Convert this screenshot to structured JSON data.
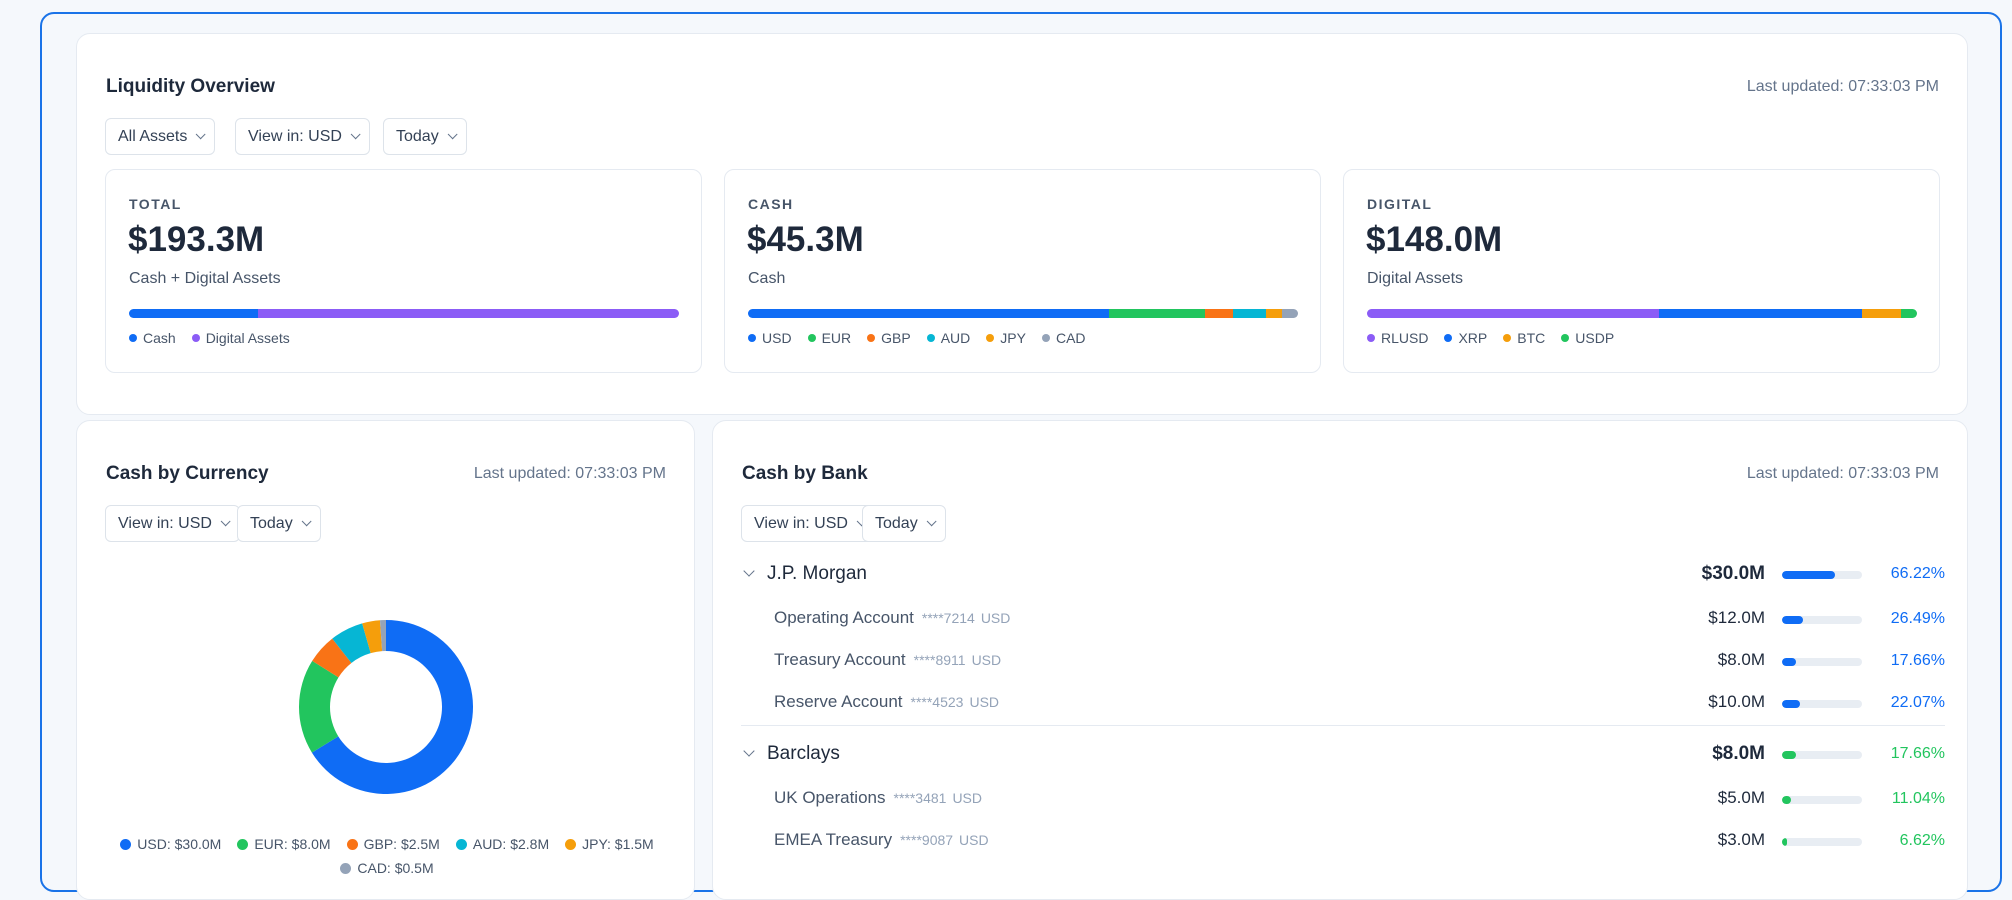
{
  "overview": {
    "title": "Liquidity Overview",
    "updated": "Last updated: 07:33:03 PM",
    "filters": [
      "All Assets",
      "View in: USD",
      "Today"
    ],
    "cards": [
      {
        "label": "TOTAL",
        "value": "$193.3M",
        "sub": "Cash + Digital Assets",
        "segments": [
          {
            "name": "Cash",
            "color": "#0f6cf5",
            "share": 23.4
          },
          {
            "name": "Digital Assets",
            "color": "#8b5cf6",
            "share": 76.6
          }
        ]
      },
      {
        "label": "CASH",
        "value": "$45.3M",
        "sub": "Cash",
        "segments": [
          {
            "name": "USD",
            "color": "#0f6cf5",
            "share": 66.2
          },
          {
            "name": "EUR",
            "color": "#22c55e",
            "share": 17.7
          },
          {
            "name": "GBP",
            "color": "#f97316",
            "share": 5.0
          },
          {
            "name": "AUD",
            "color": "#06b6d4",
            "share": 6.2
          },
          {
            "name": "JPY",
            "color": "#f59e0b",
            "share": 2.9
          },
          {
            "name": "CAD",
            "color": "#94a3b8",
            "share": 2.9
          }
        ]
      },
      {
        "label": "DIGITAL",
        "value": "$148.0M",
        "sub": "Digital Assets",
        "segments": [
          {
            "name": "RLUSD",
            "color": "#8b5cf6",
            "share": 53
          },
          {
            "name": "XRP",
            "color": "#0f6cf5",
            "share": 37
          },
          {
            "name": "BTC",
            "color": "#f59e0b",
            "share": 7
          },
          {
            "name": "USDP",
            "color": "#22c55e",
            "share": 3
          }
        ]
      }
    ]
  },
  "currency": {
    "title": "Cash by Currency",
    "updated": "Last updated: 07:33:03 PM",
    "filters": [
      "View in: USD",
      "Today"
    ],
    "legend": [
      "USD: $30.0M",
      "EUR: $8.0M",
      "GBP: $2.5M",
      "AUD: $2.8M",
      "JPY: $1.5M",
      "CAD: $0.5M"
    ]
  },
  "chart_data": {
    "type": "pie",
    "categories": [
      "USD",
      "EUR",
      "GBP",
      "AUD",
      "JPY",
      "CAD"
    ],
    "values": [
      30.0,
      8.0,
      2.5,
      2.8,
      1.5,
      0.5
    ],
    "colors": [
      "#0f6cf5",
      "#22c55e",
      "#f97316",
      "#06b6d4",
      "#f59e0b",
      "#94a3b8"
    ],
    "title": "Cash by Currency",
    "legend": "bottom"
  },
  "bank": {
    "title": "Cash by Bank",
    "updated": "Last updated: 07:33:03 PM",
    "filters": [
      "View in: USD",
      "Today"
    ],
    "banks": [
      {
        "name": "J.P. Morgan",
        "amount": "$30.0M",
        "pct": "66.22%",
        "fill": 66.22,
        "color": "#0f6cf5",
        "accounts": [
          {
            "name": "Operating Account",
            "num": "****7214",
            "cur": "USD",
            "amount": "$12.0M",
            "pct": "26.49%",
            "fill": 26.49
          },
          {
            "name": "Treasury Account",
            "num": "****8911",
            "cur": "USD",
            "amount": "$8.0M",
            "pct": "17.66%",
            "fill": 17.66
          },
          {
            "name": "Reserve Account",
            "num": "****4523",
            "cur": "USD",
            "amount": "$10.0M",
            "pct": "22.07%",
            "fill": 22.07
          }
        ]
      },
      {
        "name": "Barclays",
        "amount": "$8.0M",
        "pct": "17.66%",
        "fill": 17.66,
        "color": "#22c55e",
        "accounts": [
          {
            "name": "UK Operations",
            "num": "****3481",
            "cur": "USD",
            "amount": "$5.0M",
            "pct": "11.04%",
            "fill": 11.04
          },
          {
            "name": "EMEA Treasury",
            "num": "****9087",
            "cur": "USD",
            "amount": "$3.0M",
            "pct": "6.62%",
            "fill": 6.62
          }
        ]
      }
    ]
  }
}
